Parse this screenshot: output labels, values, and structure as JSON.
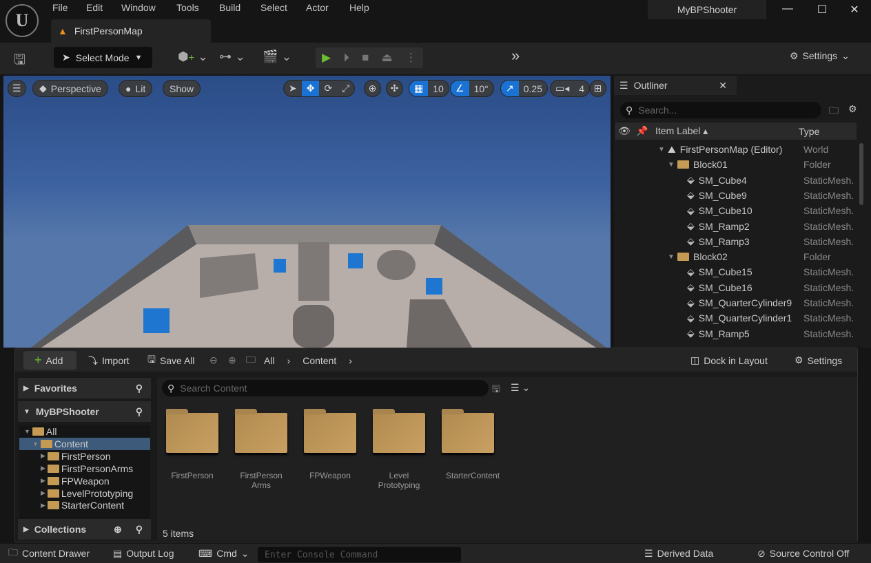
{
  "app": {
    "logo": "U",
    "project": "MyBPShooter",
    "map_tab": "FirstPersonMap"
  },
  "menu": [
    "File",
    "Edit",
    "Window",
    "Tools",
    "Build",
    "Select",
    "Actor",
    "Help"
  ],
  "window_controls": {
    "minimize": "—",
    "maximize": "☐",
    "close": "✕"
  },
  "toolbar": {
    "select_mode": "Select Mode",
    "settings": "Settings",
    "more": "»"
  },
  "viewport": {
    "perspective": "Perspective",
    "lit": "Lit",
    "show": "Show",
    "grid_snap": "10",
    "rotate_snap": "10°",
    "scale_snap": "0.25",
    "camera_speed": "4"
  },
  "outliner": {
    "title": "Outliner",
    "search_placeholder": "Search...",
    "col_label": "Item Label",
    "col_type": "Type",
    "rows": [
      {
        "label": "FirstPersonMap (Editor)",
        "type": "World",
        "kind": "world",
        "depth": 0
      },
      {
        "label": "Block01",
        "type": "Folder",
        "kind": "folder",
        "depth": 1
      },
      {
        "label": "SM_Cube4",
        "type": "StaticMesh.",
        "kind": "mesh",
        "depth": 2
      },
      {
        "label": "SM_Cube9",
        "type": "StaticMesh.",
        "kind": "mesh",
        "depth": 2
      },
      {
        "label": "SM_Cube10",
        "type": "StaticMesh.",
        "kind": "mesh",
        "depth": 2
      },
      {
        "label": "SM_Ramp2",
        "type": "StaticMesh.",
        "kind": "mesh",
        "depth": 2
      },
      {
        "label": "SM_Ramp3",
        "type": "StaticMesh.",
        "kind": "mesh",
        "depth": 2
      },
      {
        "label": "Block02",
        "type": "Folder",
        "kind": "folder",
        "depth": 1
      },
      {
        "label": "SM_Cube15",
        "type": "StaticMesh.",
        "kind": "mesh",
        "depth": 2
      },
      {
        "label": "SM_Cube16",
        "type": "StaticMesh.",
        "kind": "mesh",
        "depth": 2
      },
      {
        "label": "SM_QuarterCylinder9",
        "type": "StaticMesh.",
        "kind": "mesh",
        "depth": 2
      },
      {
        "label": "SM_QuarterCylinder1",
        "type": "StaticMesh.",
        "kind": "mesh",
        "depth": 2
      },
      {
        "label": "SM_Ramp5",
        "type": "StaticMesh.",
        "kind": "mesh",
        "depth": 2
      }
    ]
  },
  "content_drawer": {
    "add": "Add",
    "import": "Import",
    "save_all": "Save All",
    "breadcrumb": [
      "All",
      "Content"
    ],
    "dock": "Dock in Layout",
    "settings": "Settings",
    "favorites": "Favorites",
    "project": "MyBPShooter",
    "collections": "Collections",
    "search_placeholder": "Search Content",
    "tree": [
      {
        "label": "All",
        "depth": 0
      },
      {
        "label": "Content",
        "depth": 1,
        "selected": true
      },
      {
        "label": "FirstPerson",
        "depth": 2
      },
      {
        "label": "FirstPersonArms",
        "depth": 2
      },
      {
        "label": "FPWeapon",
        "depth": 2
      },
      {
        "label": "LevelPrototyping",
        "depth": 2
      },
      {
        "label": "StarterContent",
        "depth": 2
      }
    ],
    "folders": [
      "FirstPerson",
      "FirstPerson Arms",
      "FPWeapon",
      "Level Prototyping",
      "StarterContent"
    ],
    "item_count": "5 items"
  },
  "statusbar": {
    "content_drawer": "Content Drawer",
    "output_log": "Output Log",
    "cmd": "Cmd",
    "console_placeholder": "Enter Console Command",
    "derived_data": "Derived Data",
    "source_control": "Source Control Off"
  },
  "colors": {
    "accent": "#1a73d4",
    "play": "#6abe30",
    "folder": "#c49a55"
  }
}
